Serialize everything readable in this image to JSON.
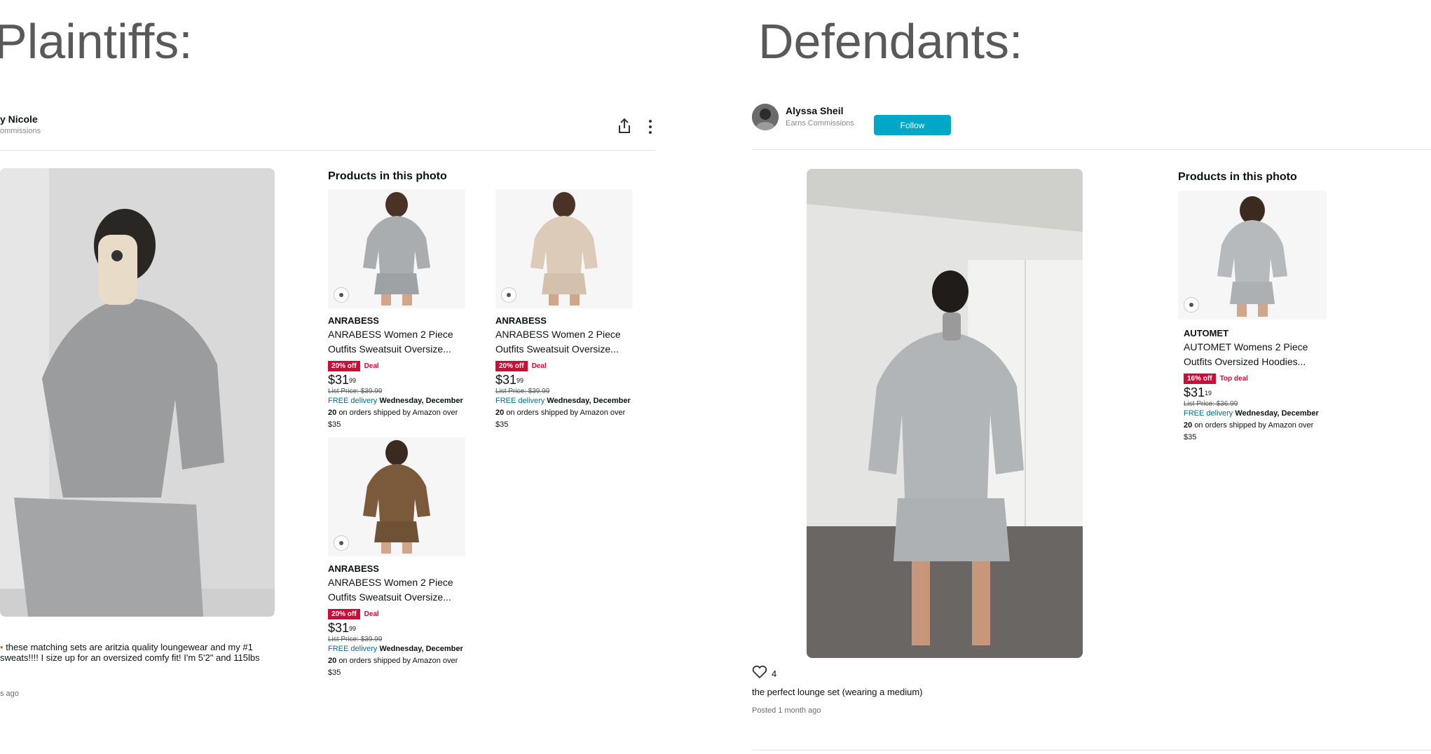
{
  "headings": {
    "plaintiffs": "Plaintiffs:",
    "defendants": "Defendants:"
  },
  "plaintiff_post": {
    "username": "y Nicole",
    "subtitle": "ommissions",
    "section_title": "Products in this photo",
    "products": [
      {
        "brand": "ANRABESS",
        "name_line1": "ANRABESS Women 2 Piece",
        "name_line2": "Outfits Sweatsuit Oversize...",
        "badge": "20% off",
        "deal": "Deal",
        "price_dollars": "$31",
        "price_cents": "99",
        "list_price_label": "List Price:",
        "list_price": "$39.99",
        "delivery_free": "FREE delivery",
        "delivery_day": "Wednesday,",
        "delivery_date": "December 20",
        "delivery_rest": "on orders shipped by Amazon over $35",
        "color": "#a9adb0"
      },
      {
        "brand": "ANRABESS",
        "name_line1": "ANRABESS Women 2 Piece",
        "name_line2": "Outfits Sweatsuit Oversize...",
        "badge": "20% off",
        "deal": "Deal",
        "price_dollars": "$31",
        "price_cents": "99",
        "list_price_label": "List Price:",
        "list_price": "$39.99",
        "delivery_free": "FREE delivery",
        "delivery_day": "Wednesday,",
        "delivery_date": "December 20",
        "delivery_rest": "on orders shipped by Amazon over $35",
        "color": "#dccbb8"
      },
      {
        "brand": "ANRABESS",
        "name_line1": "ANRABESS Women 2 Piece",
        "name_line2": "Outfits Sweatsuit Oversize...",
        "badge": "20% off",
        "deal": "Deal",
        "price_dollars": "$31",
        "price_cents": "99",
        "list_price_label": "List Price:",
        "list_price": "$39.99",
        "delivery_free": "FREE delivery",
        "delivery_day": "Wednesday,",
        "delivery_date": "December 20",
        "delivery_rest": "on orders shipped by Amazon over $35",
        "color": "#7a5a3b"
      }
    ],
    "caption_line1": "these matching sets are aritzia quality loungewear and my #1",
    "caption_line2": "sweats!!!! I size up for an oversized comfy fit! I'm 5'2\" and 115lbs",
    "posted": "s ago"
  },
  "defendant_post": {
    "username": "Alyssa Sheil",
    "subtitle": "Earns Commissions",
    "follow_label": "Follow",
    "section_title": "Products in this photo",
    "product": {
      "brand": "AUTOMET",
      "name_line1": "AUTOMET Womens 2 Piece",
      "name_line2": "Outfits Oversized Hoodies...",
      "badge": "16% off",
      "deal": "Top deal",
      "price_dollars": "$31",
      "price_cents": "19",
      "list_price_label": "List Price:",
      "list_price": "$36.99",
      "delivery_free": "FREE delivery",
      "delivery_day": "Wednesday,",
      "delivery_date": "December 20",
      "delivery_rest": "on orders shipped by Amazon over $35",
      "color": "#b7babc"
    },
    "likes": "4",
    "caption": "the perfect lounge set (wearing a medium)",
    "posted": "Posted 1 month ago"
  },
  "colors": {
    "badge_red": "#cc0c39",
    "link_teal": "#007185",
    "follow_button": "#00a8c8",
    "heading_gray": "#595959"
  },
  "icons": [
    "share-icon",
    "more-options-icon",
    "eye-icon",
    "heart-icon",
    "avatar"
  ]
}
